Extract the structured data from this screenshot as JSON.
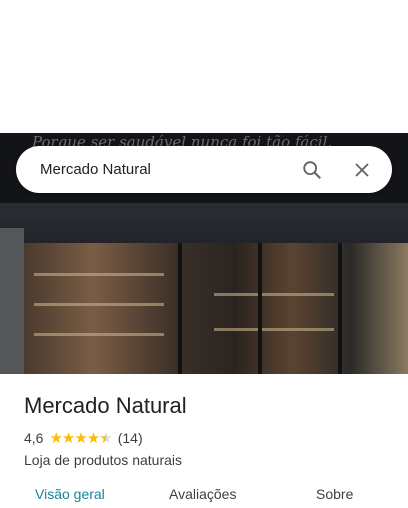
{
  "photo": {
    "slogan": "Porque ser saudável nunca foi tão fácil."
  },
  "search": {
    "value": "Mercado Natural"
  },
  "place": {
    "name": "Mercado Natural",
    "rating": "4,6",
    "rating_value": 4.6,
    "reviews": "(14)",
    "category": "Loja de produtos naturais"
  },
  "tabs": [
    {
      "label": "Visão geral",
      "active": true
    },
    {
      "label": "Avaliações"
    },
    {
      "label": "Sobre"
    }
  ],
  "colors": {
    "accent": "#188399",
    "star": "#fbbc04"
  }
}
